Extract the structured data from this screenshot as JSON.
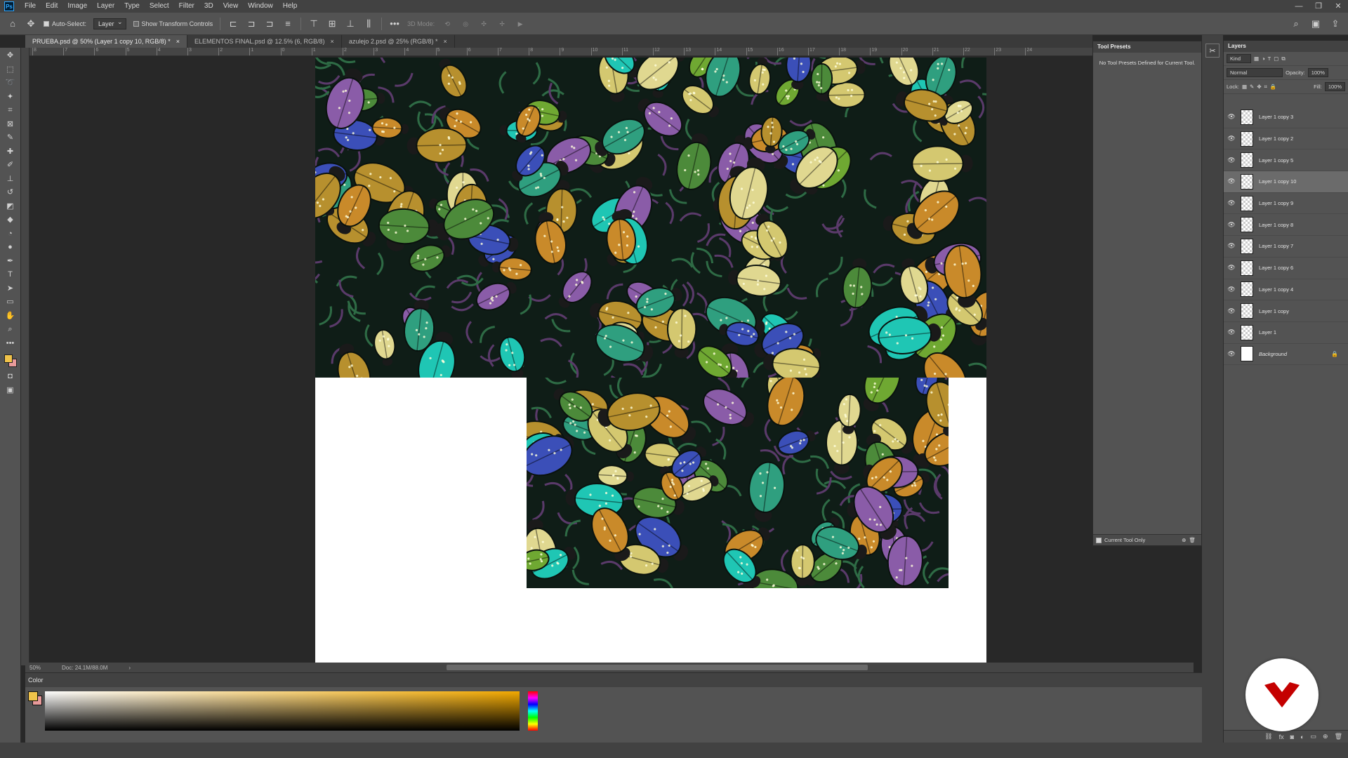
{
  "menu": {
    "app_logo": "Ps",
    "items": [
      "File",
      "Edit",
      "Image",
      "Layer",
      "Type",
      "Select",
      "Filter",
      "3D",
      "View",
      "Window",
      "Help"
    ]
  },
  "window_controls": [
    "—",
    "❐",
    "✕"
  ],
  "options_bar": {
    "auto_select_label": "Auto-Select:",
    "auto_select_target": "Layer",
    "transform_controls_label": "Show Transform Controls",
    "mode_3d_label": "3D Mode:",
    "more_label": "•••"
  },
  "tabs": [
    {
      "label": "PRUEBA.psd @ 50% (Layer 1 copy 10, RGB/8) *",
      "close": "×"
    },
    {
      "label": "ELEMENTOS FINAL.psd @ 12.5% (6, RGB/8)",
      "close": "×"
    },
    {
      "label": "azulejo 2.psd @ 25% (RGB/8) *",
      "close": "×"
    }
  ],
  "ruler_ticks": [
    "8",
    "7",
    "6",
    "5",
    "4",
    "3",
    "2",
    "1",
    "0",
    "1",
    "2",
    "3",
    "4",
    "5",
    "6",
    "7",
    "8",
    "9",
    "10",
    "11",
    "12",
    "13",
    "14",
    "15",
    "16",
    "17",
    "18",
    "19",
    "20",
    "21",
    "22",
    "23",
    "24"
  ],
  "status": {
    "zoom": "50%",
    "doc_size": "Doc: 24.1M/88.0M",
    "arrow": "›"
  },
  "color_panel": {
    "title": "Color",
    "foreground": "#f0c34a",
    "background": "#e89a9a"
  },
  "tool_presets": {
    "title": "Tool Presets",
    "message": "No Tool Presets Defined for Current Tool.",
    "current_tool_only": "Current Tool Only"
  },
  "layers_panel": {
    "title": "Layers",
    "filter_kind": "Kind",
    "blend_mode": "Normal",
    "opacity_label": "Opacity:",
    "opacity_value": "100%",
    "lock_label": "Lock:",
    "fill_label": "Fill:",
    "fill_value": "100%",
    "layers": [
      {
        "name": "Layer 1 copy 3",
        "active": false
      },
      {
        "name": "Layer 1 copy 2",
        "active": false
      },
      {
        "name": "Layer 1 copy 5",
        "active": false
      },
      {
        "name": "Layer 1 copy 10",
        "active": true
      },
      {
        "name": "Layer 1 copy 9",
        "active": false
      },
      {
        "name": "Layer 1 copy 8",
        "active": false
      },
      {
        "name": "Layer 1 copy 7",
        "active": false
      },
      {
        "name": "Layer 1 copy 6",
        "active": false
      },
      {
        "name": "Layer 1 copy 4",
        "active": false
      },
      {
        "name": "Layer 1 copy",
        "active": false
      },
      {
        "name": "Layer 1",
        "active": false
      },
      {
        "name": "Background",
        "active": false
      }
    ]
  },
  "tools": [
    "move-icon",
    "marquee-icon",
    "lasso-icon",
    "magic-wand-icon",
    "crop-icon",
    "frame-icon",
    "eyedropper-icon",
    "healing-icon",
    "brush-icon",
    "stamp-icon",
    "history-brush-icon",
    "eraser-icon",
    "paint-bucket-icon",
    "blur-icon",
    "dodge-icon",
    "pen-icon",
    "type-icon",
    "path-select-icon",
    "rectangle-icon",
    "hand-icon",
    "zoom-icon",
    "more-tools-icon"
  ],
  "tool_glyphs": [
    "✥",
    "⬚",
    "➰",
    "✦",
    "⌗",
    "⊠",
    "✎",
    "✚",
    "✐",
    "⊥",
    "↺",
    "◩",
    "◆",
    "◔",
    "●",
    "✒",
    "T",
    "➤",
    "▭",
    "✋",
    "⌕",
    "•••"
  ],
  "accent": "#c40000"
}
